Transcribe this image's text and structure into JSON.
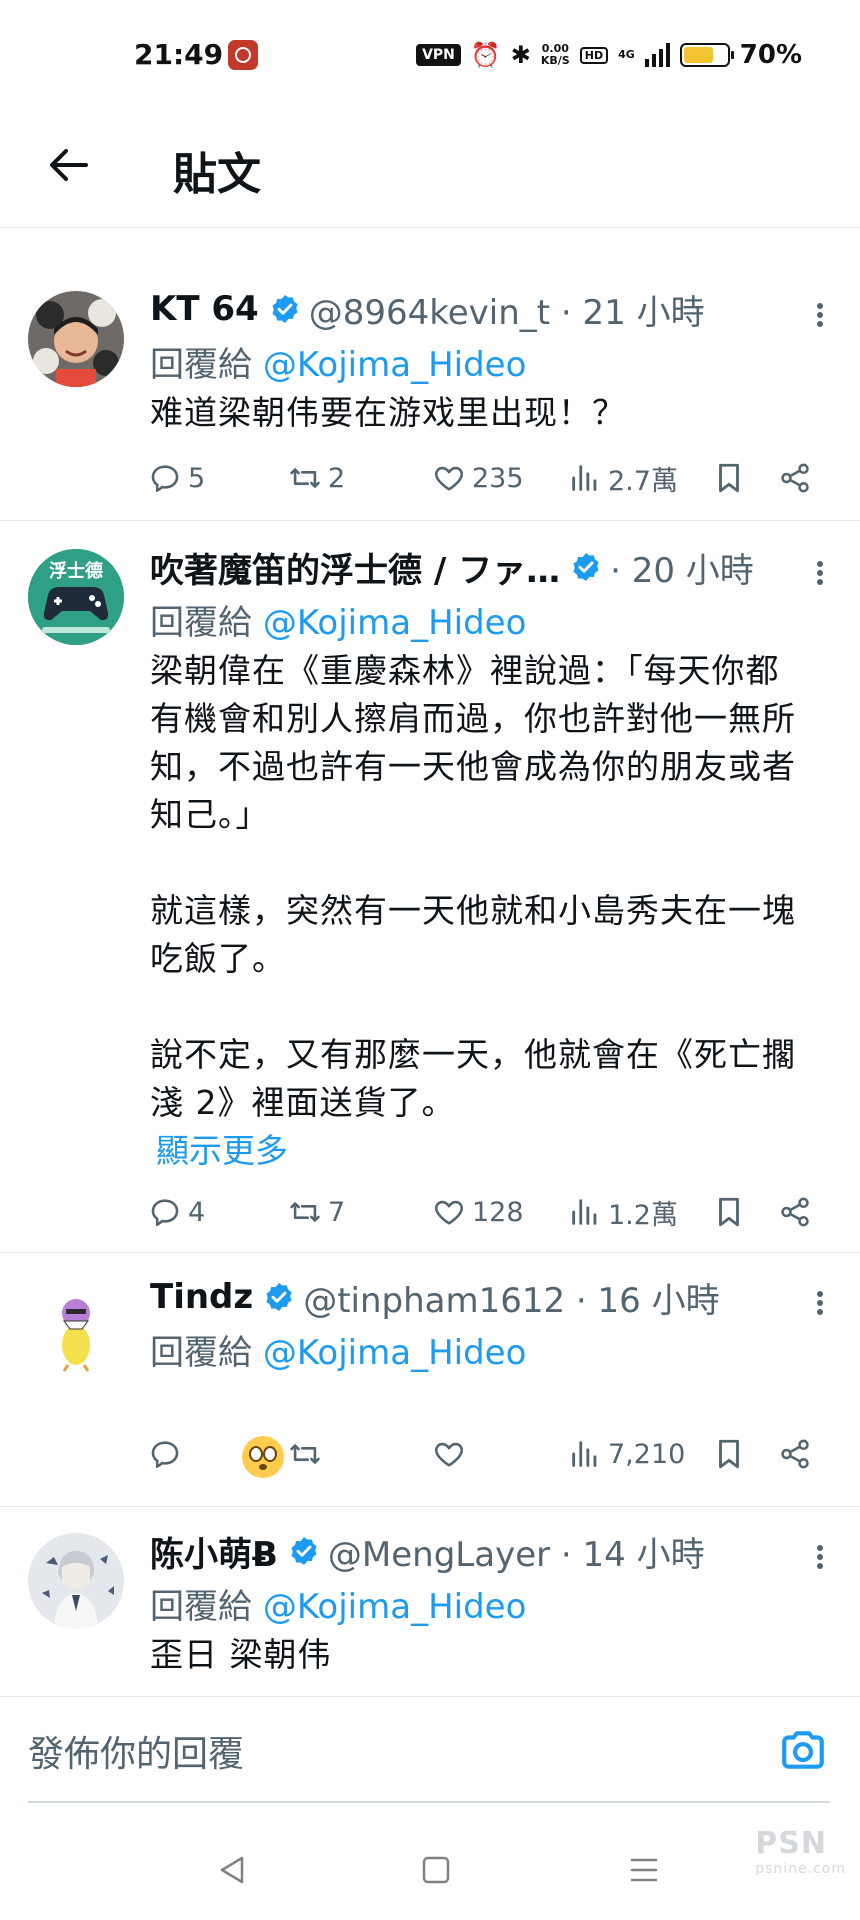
{
  "status_bar": {
    "time": "21:49",
    "vpn": "VPN",
    "speed_value": "0.00",
    "speed_unit": "KB/S",
    "hd": "HD",
    "network": "4G",
    "battery_text": "70%",
    "battery_level": 0.7,
    "battery_color": "#f3c431"
  },
  "header": {
    "title": "貼文"
  },
  "posts": [
    {
      "name": "KT 64",
      "handle": "@8964kevin_t · 21 小時",
      "reply_label": "回覆給 ",
      "reply_mention": "@Kojima_Hideo",
      "body": "难道梁朝伟要在游戏里出现！？",
      "replies": "5",
      "reposts": "2",
      "likes": "235",
      "views": "2.7萬"
    },
    {
      "name": "吹著魔笛的浮士德 / ファ…",
      "handle": "· 20 小時",
      "reply_label": "回覆給 ",
      "reply_mention": "@Kojima_Hideo",
      "avatar_text": "浮士德",
      "body": "梁朝偉在《重慶森林》裡說過：「每天你都有機會和別人擦肩而過，你也許對他一無所知，不過也許有一天他會成為你的朋友或者知己。」\n\n就這樣，突然有一天他就和小島秀夫在一塊吃飯了。\n\n說不定，又有那麼一天，他就會在《死亡擱淺 2》裡面送貨了。",
      "show_more": "顯示更多",
      "replies": "4",
      "reposts": "7",
      "likes": "128",
      "views": "1.2萬"
    },
    {
      "name": "Tindz",
      "handle": "@tinpham1612 · 16 小時",
      "reply_label": "回覆給 ",
      "reply_mention": "@Kojima_Hideo",
      "views": "7,210"
    },
    {
      "name": "陈小萌Ƀ",
      "handle": "@MengLayer · 14 小時",
      "reply_label": "回覆給 ",
      "reply_mention": "@Kojima_Hideo",
      "body": "歪日 梁朝伟"
    }
  ],
  "compose": {
    "placeholder": "發佈你的回覆"
  },
  "watermark": {
    "main": "PSN",
    "sub": "psnine.com"
  },
  "colors": {
    "accent": "#1d9bf0",
    "muted": "#536471",
    "text": "#0f1419"
  }
}
